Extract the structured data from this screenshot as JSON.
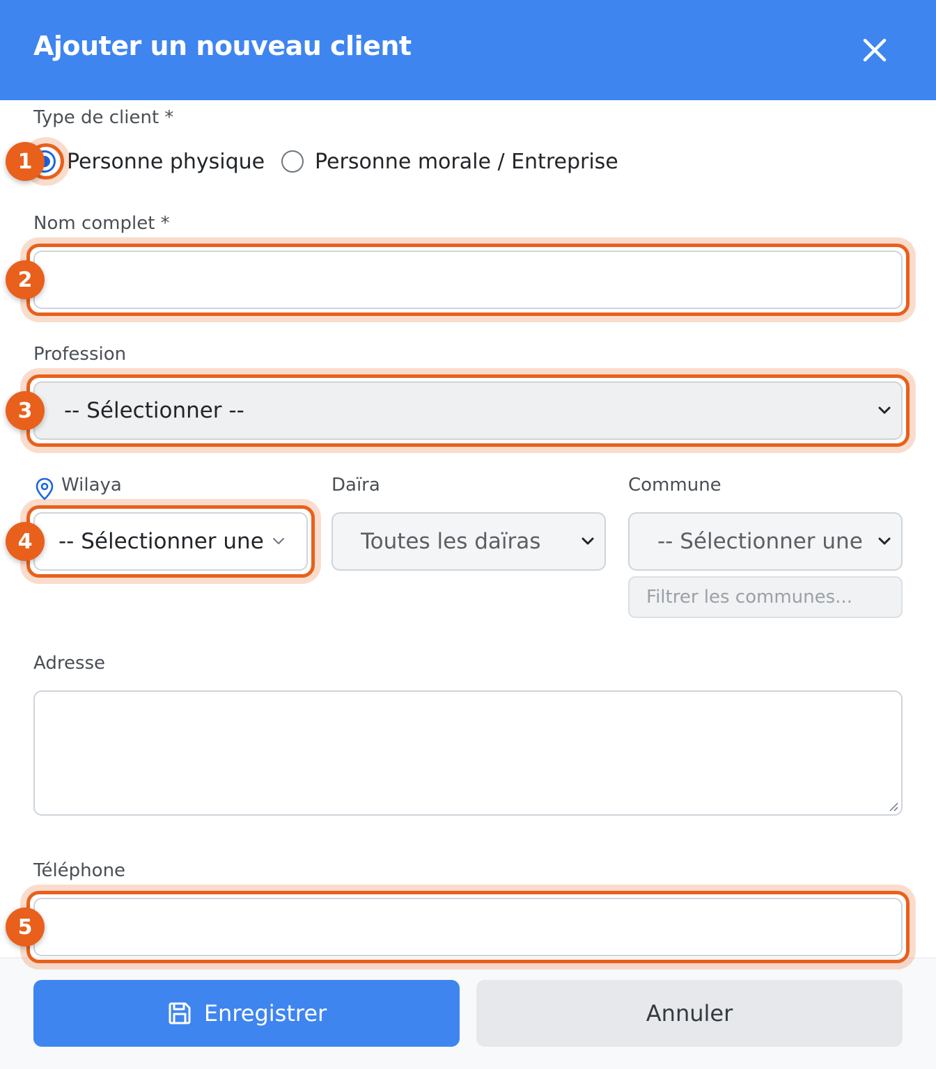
{
  "modal": {
    "title": "Ajouter un nouveau client",
    "close_icon": "close-icon",
    "header_color": "#3e85f0"
  },
  "client_type": {
    "label": "Type de client *",
    "options": [
      {
        "label": "Personne physique",
        "checked": true
      },
      {
        "label": "Personne morale / Entreprise",
        "checked": false
      }
    ]
  },
  "full_name": {
    "label": "Nom complet *",
    "value": ""
  },
  "profession": {
    "label": "Profession",
    "selected": "-- Sélectionner --"
  },
  "wilaya": {
    "label": "Wilaya",
    "icon": "map-pin-icon",
    "selected": "-- Sélectionner une"
  },
  "daira": {
    "label": "Daïra",
    "selected": "Toutes les daïras"
  },
  "commune": {
    "label": "Commune",
    "selected": "-- Sélectionner une",
    "filter_placeholder": "Filtrer les communes..."
  },
  "address": {
    "label": "Adresse",
    "value": ""
  },
  "phone": {
    "label": "Téléphone",
    "value": ""
  },
  "actions": {
    "save_label": "Enregistrer",
    "save_icon": "save-icon",
    "cancel_label": "Annuler"
  },
  "annotations": {
    "color": "#e8601c",
    "badges": [
      "1",
      "2",
      "3",
      "4",
      "5"
    ]
  }
}
